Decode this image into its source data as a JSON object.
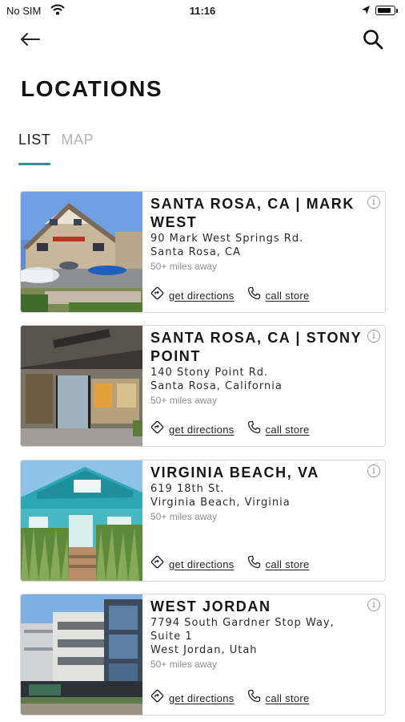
{
  "status_bar": {
    "carrier": "No SIM",
    "time": "11:16",
    "battery_level": 0.9
  },
  "header": {
    "back_icon": "arrow-left-icon",
    "search_icon": "search-icon",
    "title": "LOCATIONS"
  },
  "tabs": [
    {
      "label": "LIST",
      "active": true
    },
    {
      "label": "MAP",
      "active": false
    }
  ],
  "locations": [
    {
      "name": "SANTA ROSA, CA | MARK WEST",
      "address_line1": "90 Mark West Springs Rd.",
      "address_line2": "Santa Rosa, CA",
      "distance": "50+ miles away",
      "directions_label": "get directions",
      "call_label": "call store"
    },
    {
      "name": "SANTA ROSA, CA | STONY POINT",
      "address_line1": "140 Stony Point Rd.",
      "address_line2": "Santa Rosa, California",
      "distance": "50+ miles away",
      "directions_label": "get directions",
      "call_label": "call store"
    },
    {
      "name": "VIRGINIA BEACH, VA",
      "address_line1": "619 18th St.",
      "address_line2": "Virginia Beach, Virginia",
      "distance": "50+ miles away",
      "directions_label": "get directions",
      "call_label": "call store"
    },
    {
      "name": "WEST JORDAN",
      "address_line1": "7794 South Gardner Stop Way, Suite 1",
      "address_line2": "West Jordan, Utah",
      "distance": "50+ miles away",
      "directions_label": "get directions",
      "call_label": "call store"
    }
  ],
  "colors": {
    "accent": "#2e8f99",
    "card_border": "#d7d7d7",
    "muted_text": "#8e8e8e"
  }
}
